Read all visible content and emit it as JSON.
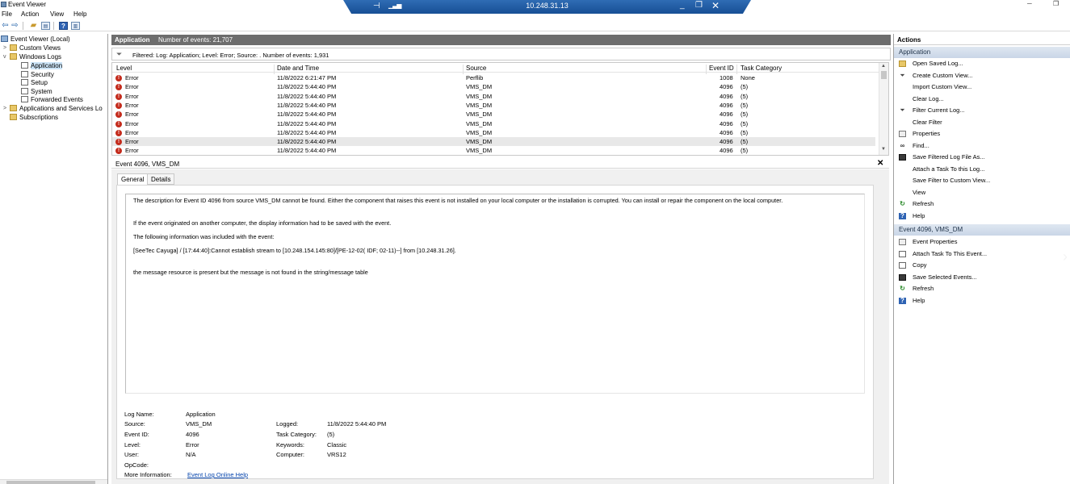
{
  "window": {
    "title": "Event Viewer",
    "remote_host": "10.248.31.13"
  },
  "menu": [
    "File",
    "Action",
    "View",
    "Help"
  ],
  "tree": {
    "root": "Event Viewer (Local)",
    "custom_views": "Custom Views",
    "windows_logs": "Windows Logs",
    "logs": [
      "Application",
      "Security",
      "Setup",
      "System",
      "Forwarded Events"
    ],
    "apps_services": "Applications and Services Lo",
    "subscriptions": "Subscriptions"
  },
  "center": {
    "header_name": "Application",
    "header_count": "Number of events: 21,707",
    "filter_text": "Filtered: Log: Application; Level: Error; Source: . Number of events: 1,931",
    "columns": [
      "Level",
      "Date and Time",
      "Source",
      "Event ID",
      "Task Category"
    ],
    "rows": [
      {
        "level": "Error",
        "datetime": "11/8/2022 6:21:47 PM",
        "source": "Perflib",
        "event_id": "1008",
        "task": "None"
      },
      {
        "level": "Error",
        "datetime": "11/8/2022 5:44:40 PM",
        "source": "VMS_DM",
        "event_id": "4096",
        "task": "(5)"
      },
      {
        "level": "Error",
        "datetime": "11/8/2022 5:44:40 PM",
        "source": "VMS_DM",
        "event_id": "4096",
        "task": "(5)"
      },
      {
        "level": "Error",
        "datetime": "11/8/2022 5:44:40 PM",
        "source": "VMS_DM",
        "event_id": "4096",
        "task": "(5)"
      },
      {
        "level": "Error",
        "datetime": "11/8/2022 5:44:40 PM",
        "source": "VMS_DM",
        "event_id": "4096",
        "task": "(5)"
      },
      {
        "level": "Error",
        "datetime": "11/8/2022 5:44:40 PM",
        "source": "VMS_DM",
        "event_id": "4096",
        "task": "(5)"
      },
      {
        "level": "Error",
        "datetime": "11/8/2022 5:44:40 PM",
        "source": "VMS_DM",
        "event_id": "4096",
        "task": "(5)"
      },
      {
        "level": "Error",
        "datetime": "11/8/2022 5:44:40 PM",
        "source": "VMS_DM",
        "event_id": "4096",
        "task": "(5)"
      },
      {
        "level": "Error",
        "datetime": "11/8/2022 5:44:40 PM",
        "source": "VMS_DM",
        "event_id": "4096",
        "task": "(5)"
      }
    ]
  },
  "detail": {
    "title": "Event 4096, VMS_DM",
    "tabs": [
      "General",
      "Details"
    ],
    "description": [
      "The description for Event ID 4096 from source VMS_DM cannot be found. Either the component that raises this event is not installed on your local computer or the installation is corrupted. You can install or repair the component on the local computer.",
      "If the event originated on another computer, the display information had to be saved with the event.",
      "The following information was included with the event:",
      "[SeeTec Cayuga] / [17:44:40]:Cannot establish stream to [10.248.154.145:80]/[PE-12-02( IDF; 02-11)--] from [10.248.31.26].",
      "the message resource is present but the message is not found in the string/message table"
    ],
    "props": {
      "log_name_label": "Log Name:",
      "log_name": "Application",
      "source_label": "Source:",
      "source": "VMS_DM",
      "logged_label": "Logged:",
      "logged": "11/8/2022 5:44:40 PM",
      "event_id_label": "Event ID:",
      "event_id": "4096",
      "task_label": "Task Category:",
      "task": "(5)",
      "level_label": "Level:",
      "level": "Error",
      "keywords_label": "Keywords:",
      "keywords": "Classic",
      "user_label": "User:",
      "user": "N/A",
      "computer_label": "Computer:",
      "computer": "VRS12",
      "opcode_label": "OpCode:",
      "more_info_label": "More Information:",
      "more_info_link": "Event Log Online Help"
    }
  },
  "actions": {
    "title": "Actions",
    "section1": "Application",
    "items1": [
      {
        "label": "Open Saved Log...",
        "icon": "folder-open-icon"
      },
      {
        "label": "Create Custom View...",
        "icon": "funnel-icon"
      },
      {
        "label": "Import Custom View...",
        "icon": ""
      },
      {
        "label": "Clear Log...",
        "icon": ""
      },
      {
        "label": "Filter Current Log...",
        "icon": "funnel-icon"
      },
      {
        "label": "Clear Filter",
        "icon": ""
      },
      {
        "label": "Properties",
        "icon": "properties-icon"
      },
      {
        "label": "Find...",
        "icon": "binoculars-icon"
      },
      {
        "label": "Save Filtered Log File As...",
        "icon": "save-icon"
      },
      {
        "label": "Attach a Task To this Log...",
        "icon": ""
      },
      {
        "label": "Save Filter to Custom View...",
        "icon": ""
      },
      {
        "label": "View",
        "icon": ""
      },
      {
        "label": "Refresh",
        "icon": "refresh-icon"
      },
      {
        "label": "Help",
        "icon": "help-icon"
      }
    ],
    "section2": "Event 4096, VMS_DM",
    "items2": [
      {
        "label": "Event Properties",
        "icon": "properties-icon"
      },
      {
        "label": "Attach Task To This Event...",
        "icon": "task-icon"
      },
      {
        "label": "Copy",
        "icon": "copy-icon"
      },
      {
        "label": "Save Selected Events...",
        "icon": "save-icon"
      },
      {
        "label": "Refresh",
        "icon": "refresh-icon"
      },
      {
        "label": "Help",
        "icon": "help-icon"
      }
    ]
  },
  "colors": {
    "header_gray": "#6d6d6d",
    "error_red": "#c42b1c",
    "rdp_blue": "#1f5ca6",
    "link_blue": "#0645ad"
  }
}
